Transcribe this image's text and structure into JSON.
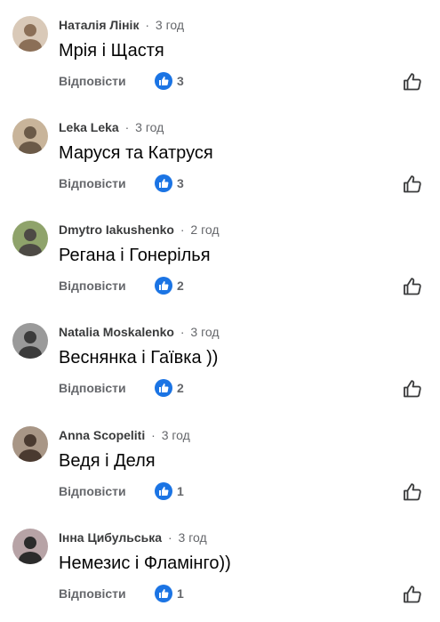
{
  "comments": [
    {
      "author": "Наталія Лінік",
      "time": "3 год",
      "text": "Мрія і Щастя",
      "reply_label": "Відповісти",
      "likes": "3",
      "avatar_bg": "#d9c9b8",
      "avatar_fg": "#8b6f57"
    },
    {
      "author": "Leka Leka",
      "time": "3 год",
      "text": "Маруся та Катруся",
      "reply_label": "Відповісти",
      "likes": "3",
      "avatar_bg": "#c8b49a",
      "avatar_fg": "#6b5a48"
    },
    {
      "author": "Dmytro Iakushenko",
      "time": "2 год",
      "text": "Регана і Гонерілья",
      "reply_label": "Відповісти",
      "likes": "2",
      "avatar_bg": "#8fa36b",
      "avatar_fg": "#4d4a45"
    },
    {
      "author": "Natalia Moskalenko",
      "time": "3 год",
      "text": "Веснянка і Гаївка ))",
      "reply_label": "Відповісти",
      "likes": "2",
      "avatar_bg": "#9a9a9a",
      "avatar_fg": "#3b3b3b"
    },
    {
      "author": "Anna Scopeliti",
      "time": "3 год",
      "text": "Ведя і Деля",
      "reply_label": "Відповісти",
      "likes": "1",
      "avatar_bg": "#a89686",
      "avatar_fg": "#4a3a30"
    },
    {
      "author": "Інна Цибульська",
      "time": "3 год",
      "text": "Немезис і Фламінго))",
      "reply_label": "Відповісти",
      "likes": "1",
      "avatar_bg": "#b7a3a6",
      "avatar_fg": "#2b2b2b"
    }
  ],
  "separator": "·",
  "icons": {
    "reaction": "like-reaction-icon",
    "like_button": "thumbs-up-outline-icon"
  },
  "colors": {
    "reaction_blue": "#1b74e4",
    "secondary_text": "#65676b"
  }
}
